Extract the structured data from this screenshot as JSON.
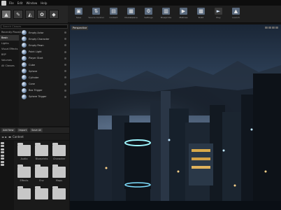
{
  "menu": {
    "items": [
      "File",
      "Edit",
      "Window",
      "Help"
    ]
  },
  "modes": {
    "items": [
      "place-icon",
      "paint-icon",
      "landscape-icon",
      "foliage-icon",
      "geometry-icon"
    ]
  },
  "toolbar": {
    "buttons": [
      {
        "label": "Save",
        "icon": "save-icon"
      },
      {
        "label": "Source Control",
        "icon": "source-control-icon"
      },
      {
        "label": "Content",
        "icon": "content-icon"
      },
      {
        "label": "Marketplace",
        "icon": "marketplace-icon"
      },
      {
        "label": "Settings",
        "icon": "settings-icon"
      },
      {
        "label": "Blueprints",
        "icon": "blueprints-icon"
      },
      {
        "label": "Matinee",
        "icon": "matinee-icon"
      },
      {
        "label": "Build",
        "icon": "build-icon"
      },
      {
        "label": "Play",
        "icon": "play-icon"
      },
      {
        "label": "Launch",
        "icon": "launch-icon"
      }
    ]
  },
  "placement": {
    "search_placeholder": "Search Classes",
    "categories": [
      "Recently Placed",
      "Basic",
      "Lights",
      "Visual Effects",
      "BSP",
      "Volumes",
      "All Classes"
    ],
    "selected_category": "Basic",
    "items": [
      "Empty Actor",
      "Empty Character",
      "Empty Pawn",
      "Point Light",
      "Player Start",
      "Cube",
      "Sphere",
      "Cylinder",
      "Cone",
      "Box Trigger",
      "Sphere Trigger"
    ]
  },
  "content_browser": {
    "add_new": "Add New",
    "import": "Import",
    "save_all": "Save All",
    "path": "Content",
    "folders": [
      "Audio",
      "Blueprints",
      "Character",
      "Effects",
      "Env",
      "Maps",
      "",
      "",
      ""
    ]
  },
  "viewport": {
    "mode_label": "Perspective"
  }
}
